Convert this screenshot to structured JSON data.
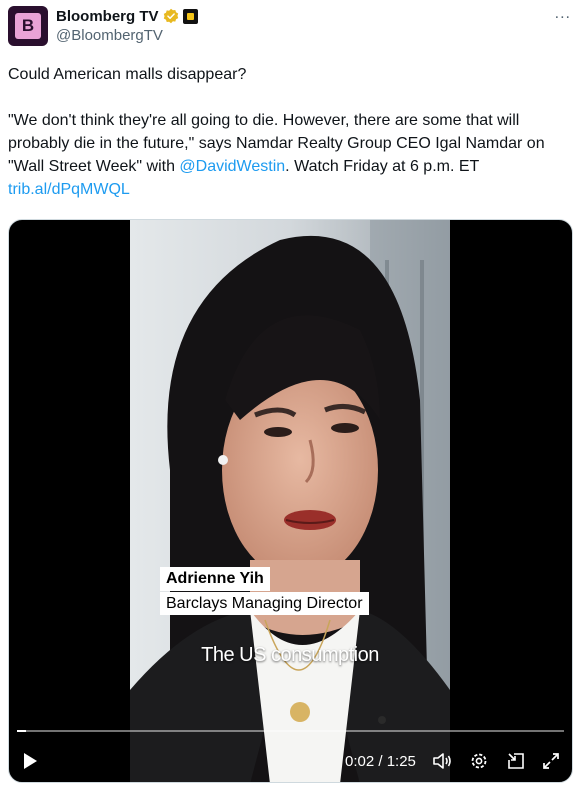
{
  "account": {
    "avatar_letter": "B",
    "display_name": "Bloomberg TV",
    "handle": "@BloombergTV",
    "verified_color": "#e8b920",
    "menu_label": "..."
  },
  "tweet": {
    "line1": "Could American malls disappear?",
    "quote": "\"We don't think they're all going to die. However, there are some that will probably die in the future,\" says Namdar Realty Group CEO Igal Namdar on \"Wall Street Week\" with ",
    "mention": "@DavidWestin",
    "after_mention": ". Watch Friday at 6 p.m. ET",
    "url": "trib.al/dPqMWQL",
    "link_color": "#1d9bf0"
  },
  "video": {
    "lower_third_name": "Adrienne Yih",
    "lower_third_title": "Barclays Managing Director",
    "caption": "The US consumption",
    "time_display": "0:02 / 1:25",
    "progress": 0.016,
    "icons": [
      "play-icon",
      "volume-icon",
      "settings-icon",
      "dock-icon",
      "fullscreen-icon"
    ]
  }
}
